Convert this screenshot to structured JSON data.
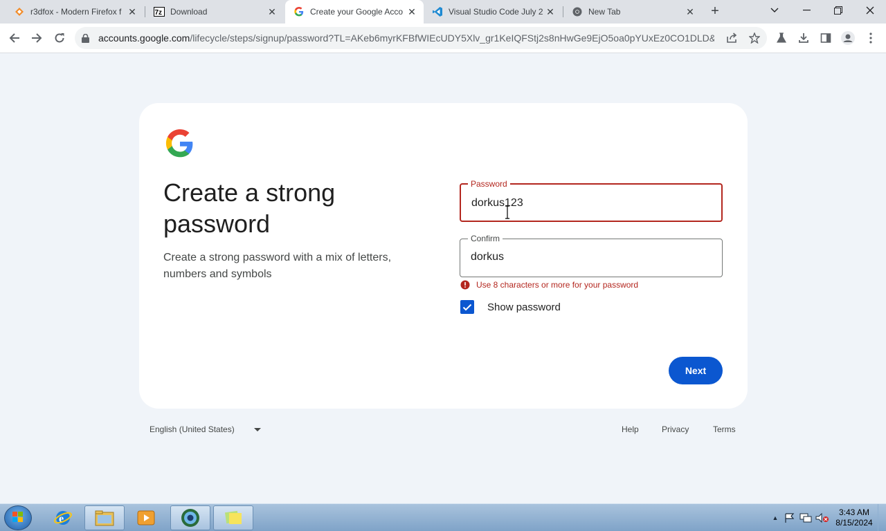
{
  "browser": {
    "tabs": [
      {
        "title": "r3dfox - Modern Firefox f",
        "icon": "r3dfox-icon",
        "active": false
      },
      {
        "title": "Download",
        "icon": "7zip-icon",
        "active": false
      },
      {
        "title": "Create your Google Acco",
        "icon": "google-icon",
        "active": true
      },
      {
        "title": "Visual Studio Code July 2",
        "icon": "vscode-icon",
        "active": false
      },
      {
        "title": "New Tab",
        "icon": "chrome-icon",
        "active": false
      }
    ],
    "url_host": "accounts.google.com",
    "url_path": "/lifecycle/steps/signup/password?TL=AKeb6myrKFBfWIEcUDY5Xlv_gr1KeIQFStj2s8nHwGe9EjO5oa0pYUxEz0CO1DLD&cont..."
  },
  "page": {
    "heading": "Create a strong password",
    "subtext": "Create a strong password with a mix of letters, numbers and symbols",
    "password": {
      "label": "Password",
      "value": "dorkus123"
    },
    "confirm": {
      "label": "Confirm",
      "value": "dorkus"
    },
    "error": "Use 8 characters or more for your password",
    "show_password": {
      "label": "Show password",
      "checked": true
    },
    "next_label": "Next"
  },
  "footer": {
    "language": "English (United States)",
    "help": "Help",
    "privacy": "Privacy",
    "terms": "Terms"
  },
  "taskbar": {
    "time": "3:43 AM",
    "date": "8/15/2024"
  },
  "colors": {
    "accent": "#0b57d0",
    "error": "#b3261e",
    "page_bg": "#f0f4f9"
  }
}
